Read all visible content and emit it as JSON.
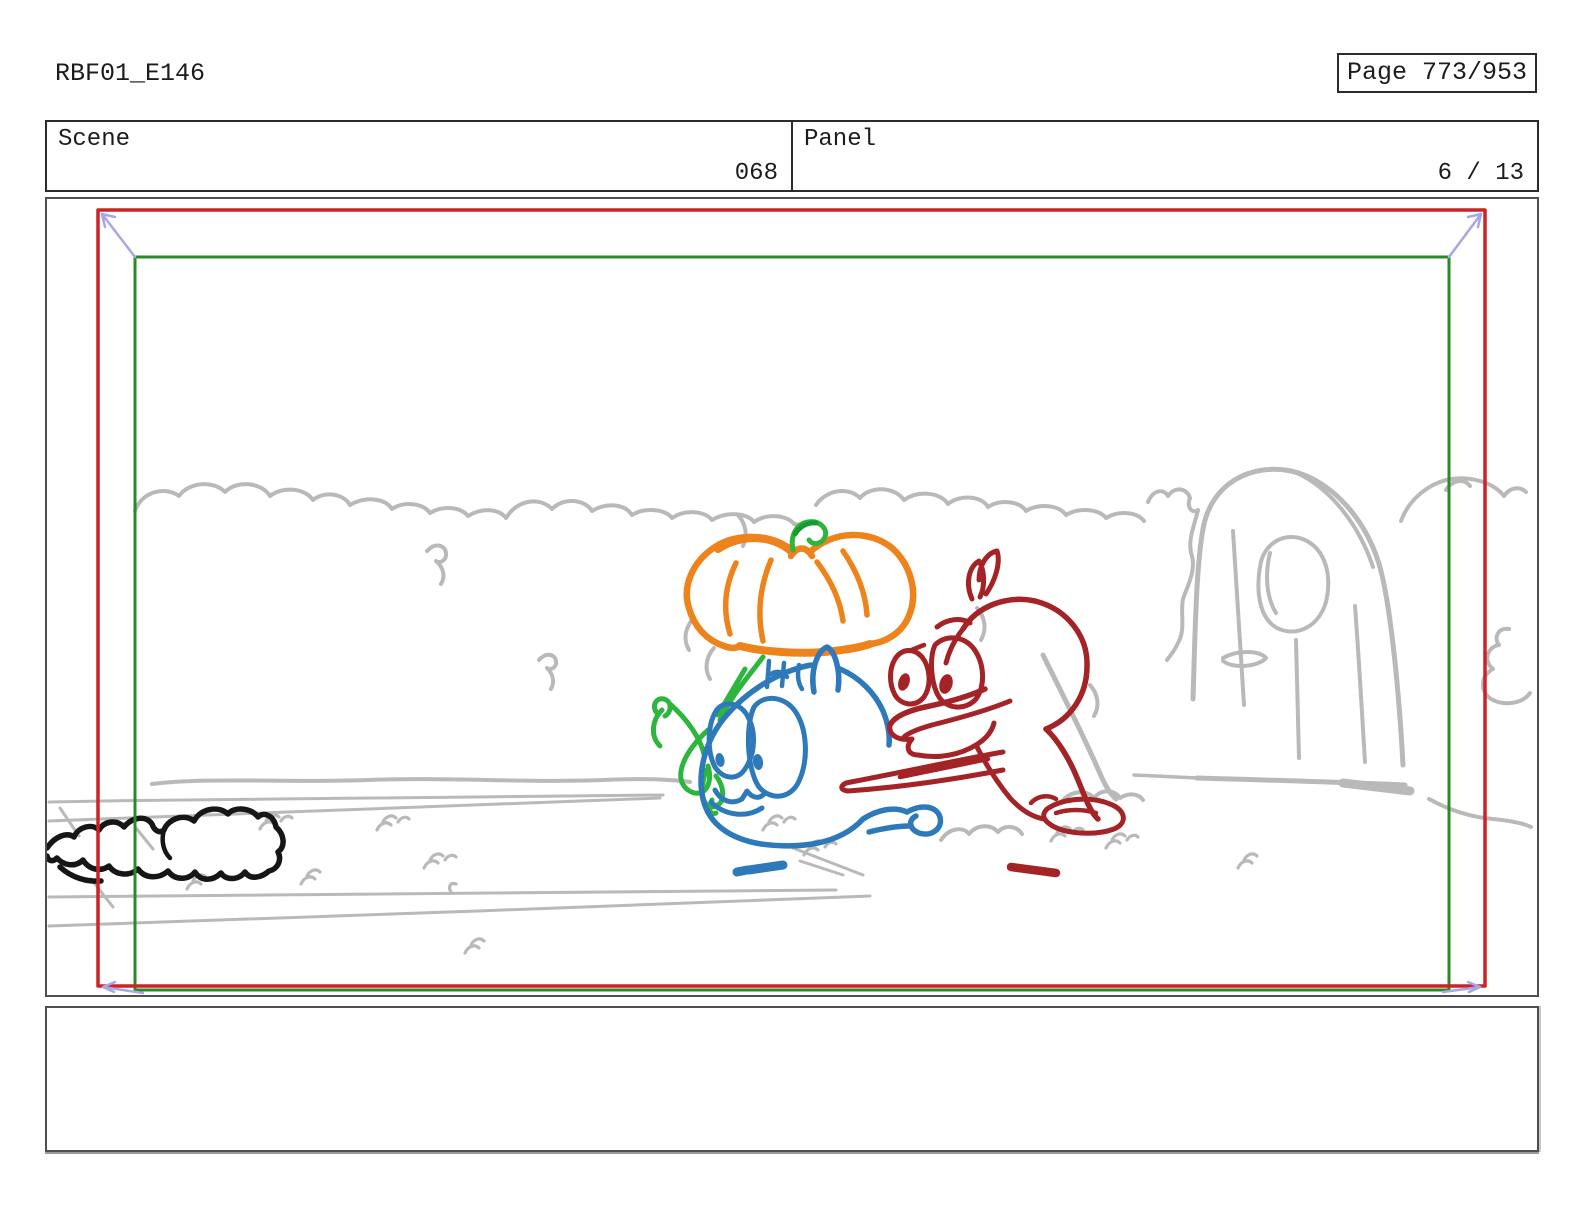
{
  "header": {
    "project_title": "RBF01_E146",
    "page_indicator": "Page 773/953"
  },
  "info_table": {
    "scene": {
      "label": "Scene",
      "value": "068"
    },
    "panel": {
      "label": "Panel",
      "value": "6 / 13"
    }
  },
  "panel_image": {
    "camera": {
      "start_frame_color": "#2a8a2a",
      "end_frame_color": "#cb2427",
      "move_arrow_color": "#a6a6e8"
    },
    "sketch_colors": {
      "background_gray": "#b9b9b9",
      "foreground_black": "#161616",
      "pumpkin_orange": "#ef831b",
      "sprout_green": "#2db53e",
      "sprout_green_dark": "#169a31",
      "character_blue": "#2e79ba",
      "character_dark_red": "#a42326"
    }
  },
  "caption_box": {
    "text": ""
  }
}
